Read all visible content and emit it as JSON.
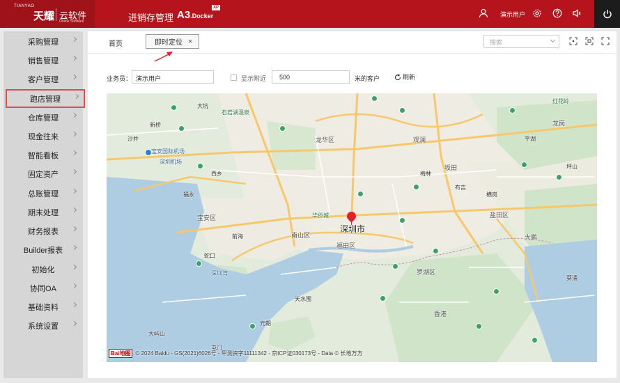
{
  "header": {
    "brand_en": "TIANYAO",
    "brand_cn": "天耀",
    "brand_cloud": "云软件",
    "brand_sub": "Online Software",
    "app_title": "进销存管理",
    "app_version_main": "A3",
    "app_version_sub": ".Docker",
    "badge": "XP",
    "user_name": "演示用户"
  },
  "sidebar": {
    "items": [
      {
        "label": "采购管理"
      },
      {
        "label": "销售管理"
      },
      {
        "label": "客户管理"
      },
      {
        "label": "跑店管理"
      },
      {
        "label": "仓库管理"
      },
      {
        "label": "现金往来"
      },
      {
        "label": "智能看板"
      },
      {
        "label": "固定资产"
      },
      {
        "label": "总账管理"
      },
      {
        "label": "期末处理"
      },
      {
        "label": "财务报表"
      },
      {
        "label": "Builder报表"
      },
      {
        "label": "初始化"
      },
      {
        "label": "协同OA"
      },
      {
        "label": "基础资料"
      },
      {
        "label": "系统设置"
      }
    ],
    "active_index": 3
  },
  "tabs": {
    "home": "首页",
    "active": "即时定位",
    "close": "×"
  },
  "search": {
    "placeholder": "搜索"
  },
  "filter": {
    "salesperson_label": "业务员：",
    "salesperson_value": "演示用户",
    "nearby_label": "显示附近",
    "distance_value": "500",
    "customers_label": "米的客户",
    "refresh_label": "刷新"
  },
  "map": {
    "city": "深圳市",
    "labels": [
      "大坑",
      "石岩湖温泉",
      "龙华区",
      "观澜",
      "坂田",
      "龙岗",
      "红花岭",
      "新桥",
      "沙井",
      "福永",
      "宝安国际机场",
      "西乡",
      "宝安区",
      "南山区",
      "福田区",
      "罗湖区",
      "盐田区",
      "深圳湾",
      "蛇口",
      "前海",
      "大鹏",
      "葵涌",
      "香港",
      "元朗",
      "天水围",
      "屯门",
      "大屿山",
      "深圳机场",
      "华侨城",
      "梅林",
      "布吉",
      "横岗",
      "平湖",
      "坪山"
    ],
    "copyright": "© 2024 Baidu - GS(2021)6026号 - 甲测资字11111342 - 京ICP证030173号 - Data © 长地万方",
    "copyright_logo": "Bai",
    "copyright_logo_2": "地图"
  }
}
